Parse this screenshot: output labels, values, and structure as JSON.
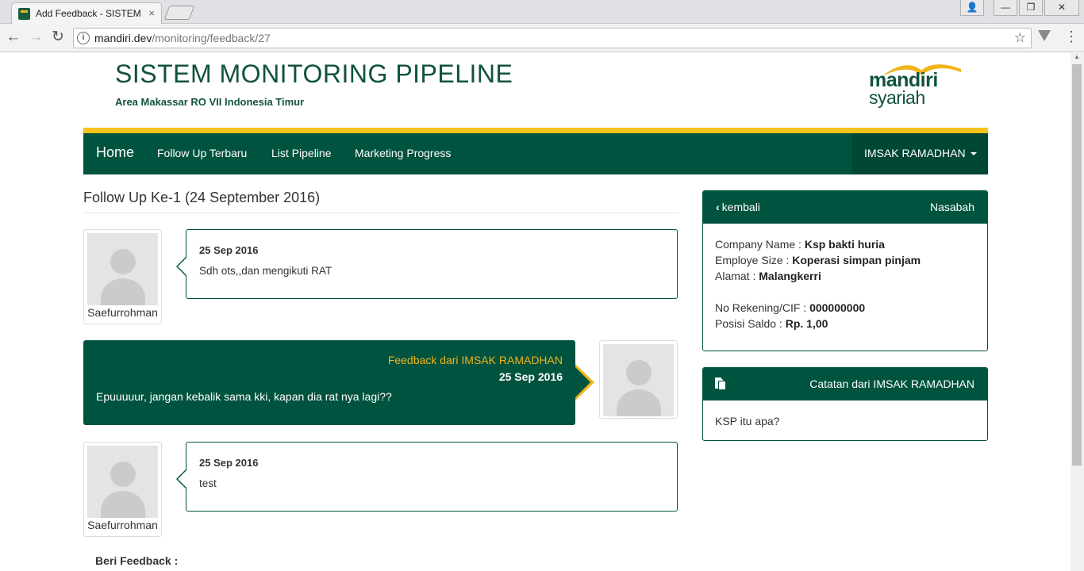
{
  "browser": {
    "tab_title": "Add Feedback - SISTEM MONITORING PIPELINE",
    "tab_close": "×",
    "url_host": "mandiri.dev",
    "url_path": "/monitoring/feedback/27",
    "window_buttons": {
      "user": "👤",
      "minimize": "—",
      "restore": "❐",
      "close": "✕"
    },
    "icons": {
      "back": "←",
      "forward": "→",
      "reload": "↻",
      "star": "☆",
      "menu": "⋮",
      "info": "i"
    }
  },
  "header": {
    "title": "SISTEM MONITORING PIPELINE",
    "subtitle": "Area Makassar RO VII Indonesia Timur",
    "logo": {
      "line1": "mandiri",
      "line2": "syariah",
      "colors": {
        "green": "#11523f",
        "gold": "#f0b41b"
      }
    }
  },
  "navbar": {
    "brand": "Home",
    "links": [
      "Follow Up Terbaru",
      "List Pipeline",
      "Marketing Progress"
    ],
    "user": "IMSAK RAMADHAN",
    "colors": {
      "bar": "#00533f",
      "accent": "#f7c31b"
    }
  },
  "followup": {
    "title": "Follow Up Ke-1 (24 September 2016)",
    "entries": [
      {
        "author": "Saefurrohman",
        "date": "25 Sep 2016",
        "text": "Sdh ots,,dan mengikuti RAT"
      },
      {
        "from": "Feedback dari IMSAK RAMADHAN",
        "date": "25 Sep 2016",
        "text": "Epuuuuur, jangan kebalik sama kki, kapan dia rat nya lagi??"
      },
      {
        "author": "Saefurrohman",
        "date": "25 Sep 2016",
        "text": "test"
      }
    ],
    "feedback_label": "Beri Feedback :"
  },
  "nasabah_panel": {
    "back_label": "kembali",
    "heading": "Nasabah",
    "rows": [
      {
        "label": "Company Name : ",
        "value": "Ksp bakti huria"
      },
      {
        "label": "Employe Size : ",
        "value": "Koperasi simpan pinjam"
      },
      {
        "label": "Alamat : ",
        "value": "Malangkerri"
      },
      {
        "label": "No Rekening/CIF : ",
        "value": "000000000"
      },
      {
        "label": "Posisi Saldo : ",
        "value": "Rp. 1,00"
      }
    ]
  },
  "catatan_panel": {
    "heading": "Catatan dari IMSAK RAMADHAN",
    "text": "KSP itu apa?"
  }
}
